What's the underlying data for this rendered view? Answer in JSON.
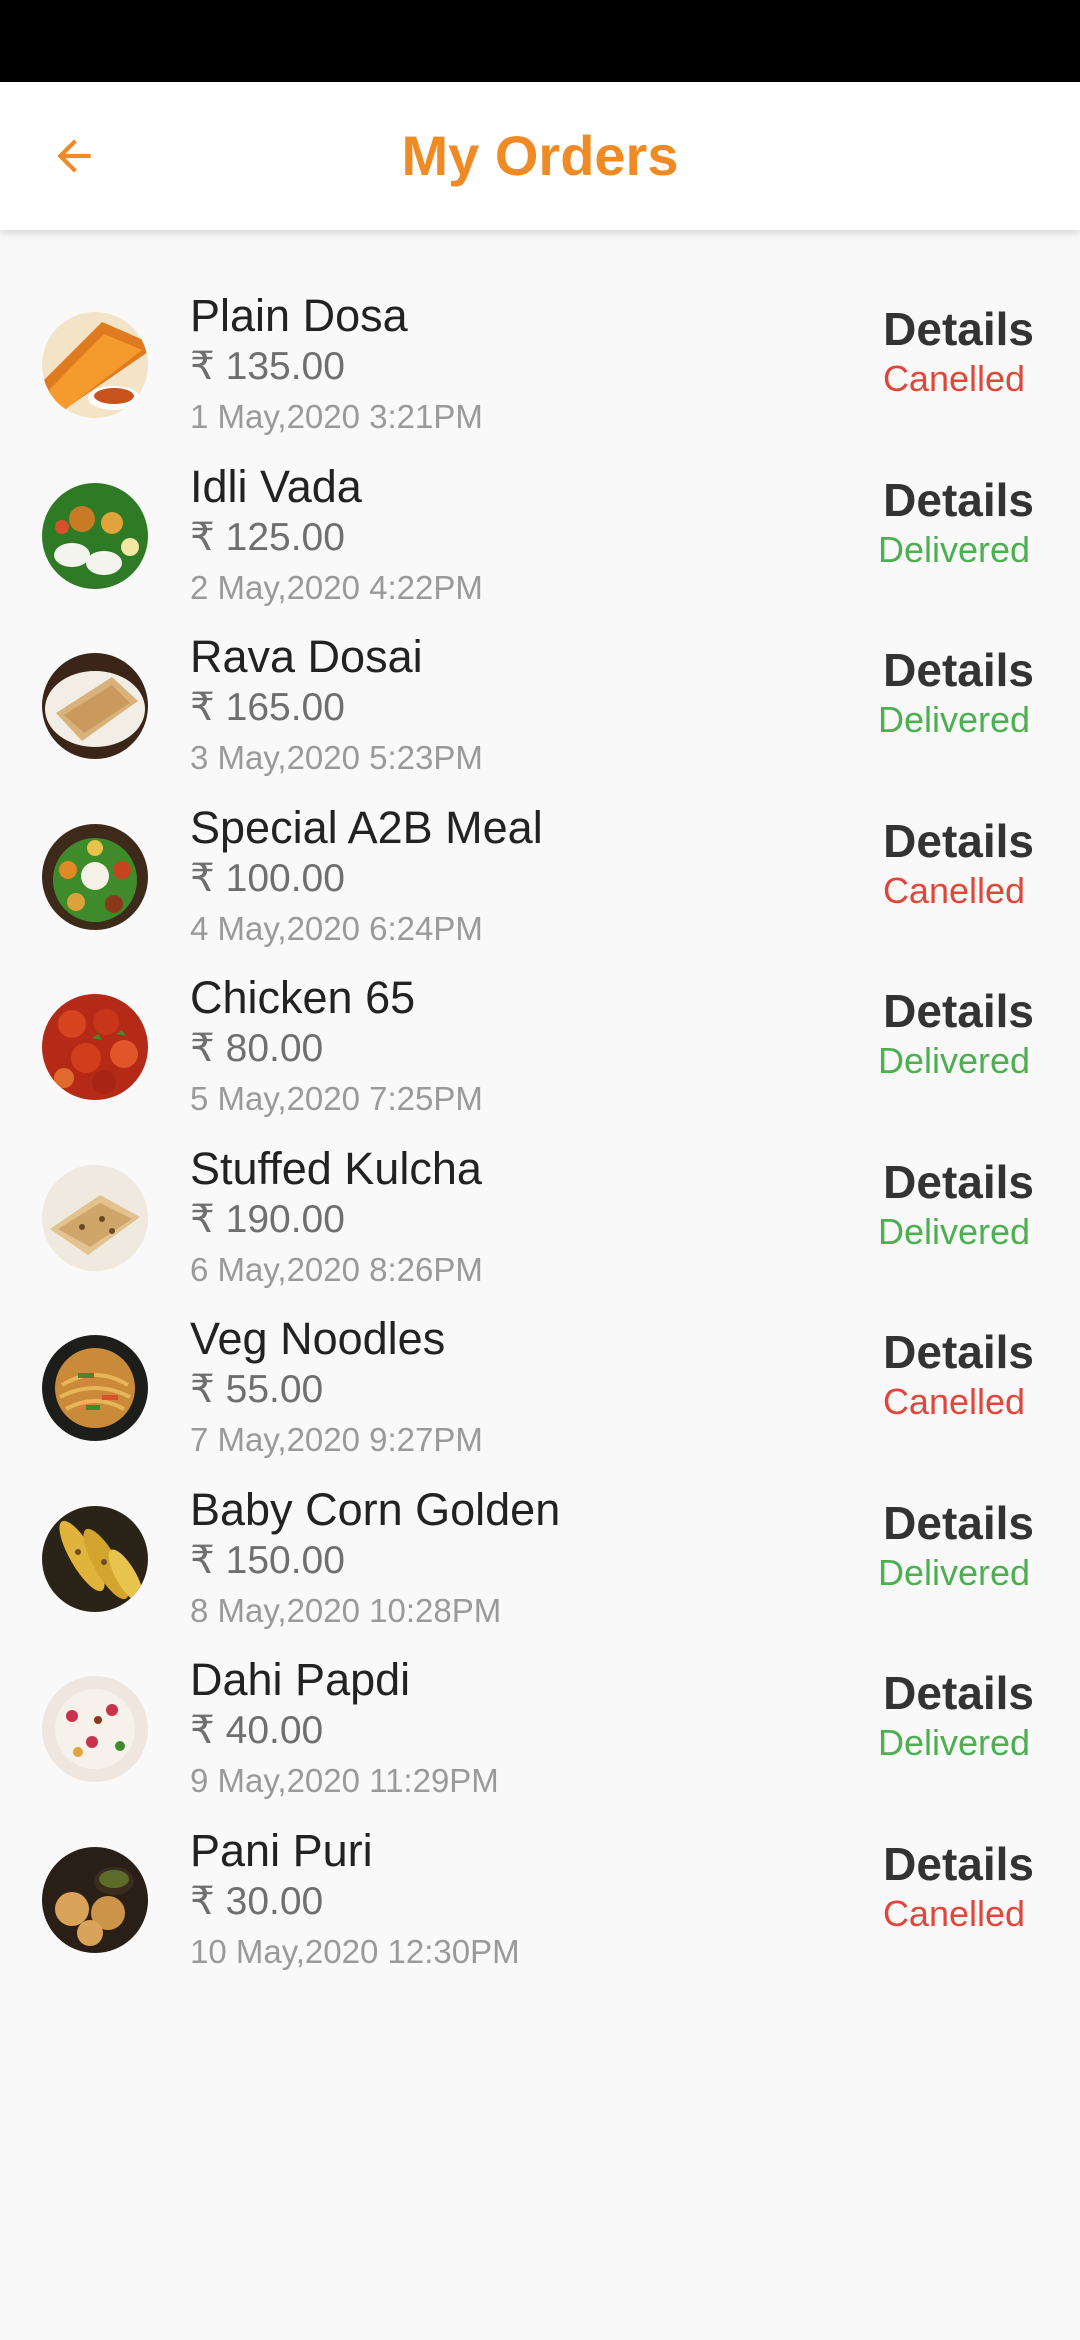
{
  "header": {
    "title": "My Orders",
    "back_icon": "arrow-left-icon"
  },
  "colors": {
    "accent": "#f08a24",
    "cancelled": "#e0473c",
    "delivered": "#4caf50"
  },
  "orders": [
    {
      "name": "Plain Dosa",
      "price": "₹ 135.00",
      "date": "1 May,2020 3:21PM",
      "details_label": "Details",
      "status": "Canelled",
      "status_type": "cancelled",
      "thumb_icon": "plain-dosa-photo"
    },
    {
      "name": "Idli Vada",
      "price": "₹ 125.00",
      "date": "2 May,2020 4:22PM",
      "details_label": "Details",
      "status": "Delivered",
      "status_type": "delivered",
      "thumb_icon": "idli-vada-photo"
    },
    {
      "name": "Rava Dosai",
      "price": "₹ 165.00",
      "date": "3 May,2020 5:23PM",
      "details_label": "Details",
      "status": "Delivered",
      "status_type": "delivered",
      "thumb_icon": "rava-dosai-photo"
    },
    {
      "name": "Special A2B Meal",
      "price": "₹ 100.00",
      "date": "4 May,2020 6:24PM",
      "details_label": "Details",
      "status": "Canelled",
      "status_type": "cancelled",
      "thumb_icon": "a2b-meal-photo"
    },
    {
      "name": "Chicken 65",
      "price": "₹ 80.00",
      "date": "5 May,2020 7:25PM",
      "details_label": "Details",
      "status": "Delivered",
      "status_type": "delivered",
      "thumb_icon": "chicken-65-photo"
    },
    {
      "name": "Stuffed Kulcha",
      "price": "₹ 190.00",
      "date": "6 May,2020 8:26PM",
      "details_label": "Details",
      "status": "Delivered",
      "status_type": "delivered",
      "thumb_icon": "stuffed-kulcha-photo"
    },
    {
      "name": "Veg Noodles",
      "price": "₹ 55.00",
      "date": "7 May,2020 9:27PM",
      "details_label": "Details",
      "status": "Canelled",
      "status_type": "cancelled",
      "thumb_icon": "veg-noodles-photo"
    },
    {
      "name": "Baby Corn Golden",
      "price": "₹ 150.00",
      "date": "8 May,2020 10:28PM",
      "details_label": "Details",
      "status": "Delivered",
      "status_type": "delivered",
      "thumb_icon": "baby-corn-photo"
    },
    {
      "name": "Dahi Papdi",
      "price": "₹ 40.00",
      "date": "9 May,2020 11:29PM",
      "details_label": "Details",
      "status": "Delivered",
      "status_type": "delivered",
      "thumb_icon": "dahi-papdi-photo"
    },
    {
      "name": "Pani Puri",
      "price": "₹ 30.00",
      "date": "10 May,2020 12:30PM",
      "details_label": "Details",
      "status": "Canelled",
      "status_type": "cancelled",
      "thumb_icon": "pani-puri-photo"
    }
  ]
}
